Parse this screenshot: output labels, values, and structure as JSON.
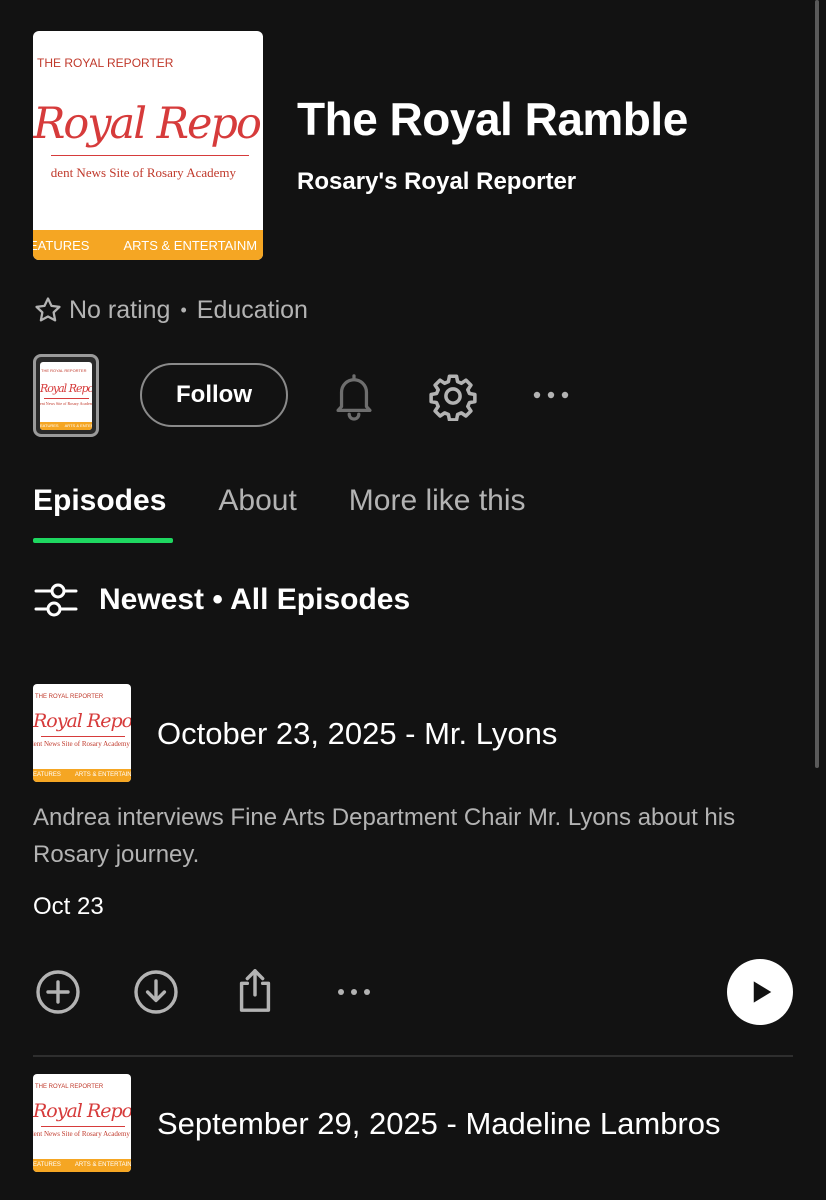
{
  "cover": {
    "top_text": "THE ROYAL REPORTER",
    "script_text": "Royal Reporter",
    "subtitle": "dent News Site of Rosary Academy",
    "band_left": "EATURES",
    "band_right": "ARTS & ENTERTAINM"
  },
  "show": {
    "title": "The Royal Ramble",
    "author": "Rosary's Royal Reporter",
    "rating": "No rating",
    "separator": "•",
    "category": "Education"
  },
  "actions": {
    "follow_label": "Follow"
  },
  "tabs": [
    {
      "label": "Episodes",
      "active": true
    },
    {
      "label": "About",
      "active": false
    },
    {
      "label": "More like this",
      "active": false
    }
  ],
  "filter": {
    "label": "Newest • All Episodes"
  },
  "episodes": [
    {
      "title": "October 23, 2025 - Mr. Lyons",
      "description": "Andrea interviews Fine Arts Department Chair Mr. Lyons about his Rosary journey.",
      "date": "Oct 23"
    },
    {
      "title": "September 29, 2025 - Madeline Lambros"
    }
  ],
  "colors": {
    "background": "#121212",
    "accent": "#1ed760",
    "muted_text": "#b3b3b3",
    "cover_red": "#d63b3b",
    "cover_band": "#f5a623"
  },
  "icons": {
    "rating": "star-outline-icon",
    "notify": "bell-icon",
    "settings": "gear-icon",
    "more": "more-horizontal-icon",
    "filter": "sliders-icon",
    "add": "plus-circle-icon",
    "download": "download-circle-icon",
    "share": "share-icon",
    "play": "play-icon"
  }
}
